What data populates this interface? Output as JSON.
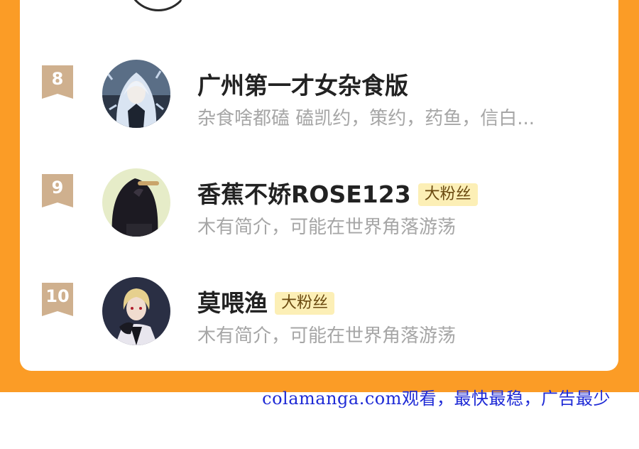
{
  "colors": {
    "page_background": "#fb9c26",
    "card_background": "#ffffff",
    "rank_badge": "#cfb08e",
    "name_text": "#222222",
    "description_text": "#a6a6a6",
    "tag_background": "#fcefb6",
    "tag_text": "#6b4a10",
    "watermark_text": "#1f2bd6"
  },
  "ranking": {
    "items": [
      {
        "rank": "8",
        "name": "广州第一才女杂食版",
        "tag": "",
        "description": "杂食啥都磕 磕凯约，策约，药鱼，信白...",
        "avatar_icon": "white-haired-anime-girl-avatar"
      },
      {
        "rank": "9",
        "name": "香蕉不娇ROSE123",
        "tag": "大粉丝",
        "description": "木有简介，可能在世界角落游荡",
        "avatar_icon": "dark-haired-girl-avatar"
      },
      {
        "rank": "10",
        "name": "莫喂渔",
        "tag": "大粉丝",
        "description": "木有简介，可能在世界角落游荡",
        "avatar_icon": "blond-anime-boy-avatar"
      }
    ]
  },
  "watermark": {
    "text": "colamanga.com观看，最快最稳，广告最少"
  }
}
